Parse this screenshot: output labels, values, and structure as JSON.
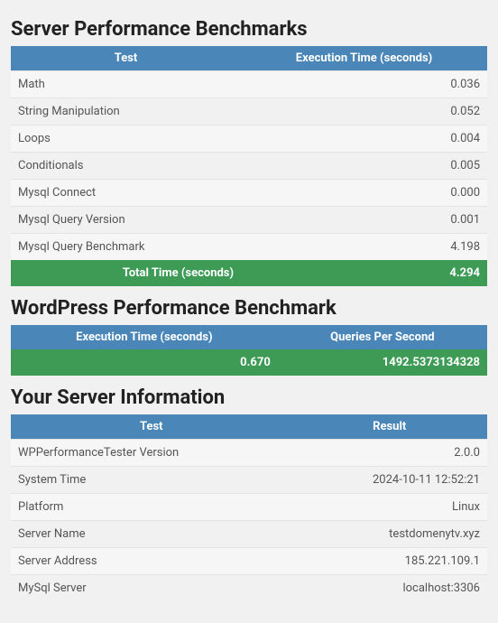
{
  "section1": {
    "title": "Server Performance Benchmarks",
    "headers": {
      "col1": "Test",
      "col2": "Execution Time (seconds)"
    },
    "rows": [
      {
        "test": "Math",
        "time": "0.036"
      },
      {
        "test": "String Manipulation",
        "time": "0.052"
      },
      {
        "test": "Loops",
        "time": "0.004"
      },
      {
        "test": "Conditionals",
        "time": "0.005"
      },
      {
        "test": "Mysql Connect",
        "time": "0.000"
      },
      {
        "test": "Mysql Query Version",
        "time": "0.001"
      },
      {
        "test": "Mysql Query Benchmark",
        "time": "4.198"
      }
    ],
    "total": {
      "label": "Total Time (seconds)",
      "value": "4.294"
    }
  },
  "section2": {
    "title": "WordPress Performance Benchmark",
    "headers": {
      "col1": "Execution Time (seconds)",
      "col2": "Queries Per Second"
    },
    "row": {
      "time": "0.670",
      "qps": "1492.5373134328"
    }
  },
  "section3": {
    "title": "Your Server Information",
    "headers": {
      "col1": "Test",
      "col2": "Result"
    },
    "rows": [
      {
        "k": "WPPerformanceTester Version",
        "v": "2.0.0"
      },
      {
        "k": "System Time",
        "v": "2024-10-11 12:52:21"
      },
      {
        "k": "Platform",
        "v": "Linux"
      },
      {
        "k": "Server Name",
        "v": "testdomenytv.xyz"
      },
      {
        "k": "Server Address",
        "v": "185.221.109.1"
      },
      {
        "k": "MySql Server",
        "v": "localhost:3306"
      }
    ]
  },
  "chart_data": [
    {
      "type": "table",
      "title": "Server Performance Benchmarks",
      "columns": [
        "Test",
        "Execution Time (seconds)"
      ],
      "rows": [
        [
          "Math",
          0.036
        ],
        [
          "String Manipulation",
          0.052
        ],
        [
          "Loops",
          0.004
        ],
        [
          "Conditionals",
          0.005
        ],
        [
          "Mysql Connect",
          0.0
        ],
        [
          "Mysql Query Version",
          0.001
        ],
        [
          "Mysql Query Benchmark",
          4.198
        ]
      ],
      "total": [
        "Total Time (seconds)",
        4.294
      ]
    },
    {
      "type": "table",
      "title": "WordPress Performance Benchmark",
      "columns": [
        "Execution Time (seconds)",
        "Queries Per Second"
      ],
      "rows": [
        [
          0.67,
          1492.5373134328
        ]
      ]
    },
    {
      "type": "table",
      "title": "Your Server Information",
      "columns": [
        "Test",
        "Result"
      ],
      "rows": [
        [
          "WPPerformanceTester Version",
          "2.0.0"
        ],
        [
          "System Time",
          "2024-10-11 12:52:21"
        ],
        [
          "Platform",
          "Linux"
        ],
        [
          "Server Name",
          "testdomenytv.xyz"
        ],
        [
          "Server Address",
          "185.221.109.1"
        ],
        [
          "MySql Server",
          "localhost:3306"
        ]
      ]
    }
  ]
}
